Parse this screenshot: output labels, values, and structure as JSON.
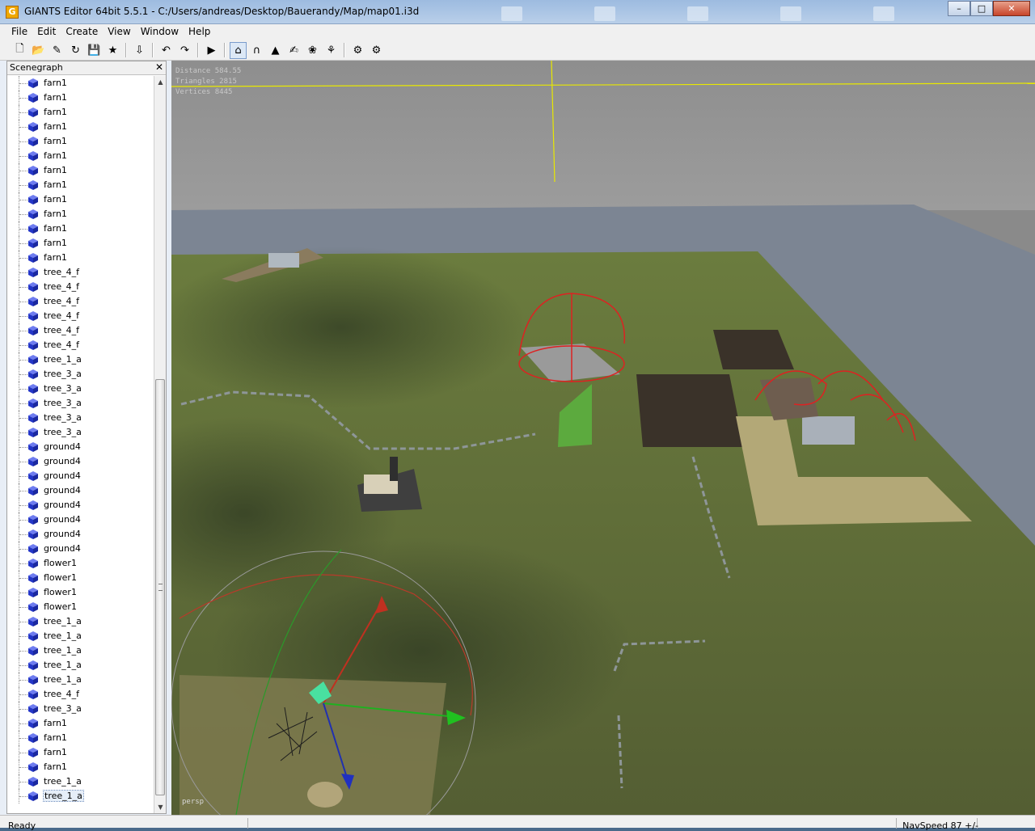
{
  "titlebar": {
    "app_letter": "G",
    "title": "GIANTS Editor 64bit 5.5.1 - C:/Users/andreas/Desktop/Bauerandy/Map/map01.i3d",
    "minimize": "–",
    "maximize": "□",
    "close": "✕"
  },
  "menu": [
    {
      "label": "File"
    },
    {
      "label": "Edit"
    },
    {
      "label": "Create"
    },
    {
      "label": "View"
    },
    {
      "label": "Window"
    },
    {
      "label": "Help"
    }
  ],
  "toolbar": {
    "buttons": [
      {
        "icon": "new-file-icon",
        "glyph": "🗋"
      },
      {
        "icon": "open-folder-icon",
        "glyph": "📂"
      },
      {
        "icon": "edit-icon",
        "glyph": "✎"
      },
      {
        "icon": "refresh-icon",
        "glyph": "↻"
      },
      {
        "icon": "save-icon",
        "glyph": "💾"
      },
      {
        "icon": "save-as-icon",
        "glyph": "★"
      },
      {
        "icon": "import-icon",
        "glyph": "⇩"
      },
      {
        "icon": "undo-icon",
        "glyph": "↶"
      },
      {
        "icon": "redo-icon",
        "glyph": "↷"
      },
      {
        "icon": "play-icon",
        "glyph": "▶"
      },
      {
        "icon": "home-camera-icon",
        "glyph": "⌂"
      },
      {
        "icon": "magnet-icon",
        "glyph": "∩"
      },
      {
        "icon": "terrain-sculpt-icon",
        "glyph": "▲"
      },
      {
        "icon": "terrain-paint-icon",
        "glyph": "✍"
      },
      {
        "icon": "foliage-paint-icon",
        "glyph": "❀"
      },
      {
        "icon": "plant-icon",
        "glyph": "⚘"
      },
      {
        "icon": "settings-icon",
        "glyph": "⚙"
      },
      {
        "icon": "advanced-settings-icon",
        "glyph": "⚙"
      }
    ]
  },
  "scenegraph": {
    "title": "Scenegraph",
    "close_glyph": "✕",
    "items": [
      {
        "label": "farn1"
      },
      {
        "label": "farn1"
      },
      {
        "label": "farn1"
      },
      {
        "label": "farn1"
      },
      {
        "label": "farn1"
      },
      {
        "label": "farn1"
      },
      {
        "label": "farn1"
      },
      {
        "label": "farn1"
      },
      {
        "label": "farn1"
      },
      {
        "label": "farn1"
      },
      {
        "label": "farn1"
      },
      {
        "label": "farn1"
      },
      {
        "label": "farn1"
      },
      {
        "label": "tree_4_f"
      },
      {
        "label": "tree_4_f"
      },
      {
        "label": "tree_4_f"
      },
      {
        "label": "tree_4_f"
      },
      {
        "label": "tree_4_f"
      },
      {
        "label": "tree_4_f"
      },
      {
        "label": "tree_1_a"
      },
      {
        "label": "tree_3_a"
      },
      {
        "label": "tree_3_a"
      },
      {
        "label": "tree_3_a"
      },
      {
        "label": "tree_3_a"
      },
      {
        "label": "tree_3_a"
      },
      {
        "label": "ground4"
      },
      {
        "label": "ground4"
      },
      {
        "label": "ground4"
      },
      {
        "label": "ground4"
      },
      {
        "label": "ground4"
      },
      {
        "label": "ground4"
      },
      {
        "label": "ground4"
      },
      {
        "label": "ground4"
      },
      {
        "label": "flower1"
      },
      {
        "label": "flower1"
      },
      {
        "label": "flower1"
      },
      {
        "label": "flower1"
      },
      {
        "label": "tree_1_a"
      },
      {
        "label": "tree_1_a"
      },
      {
        "label": "tree_1_a"
      },
      {
        "label": "tree_1_a"
      },
      {
        "label": "tree_1_a"
      },
      {
        "label": "tree_4_f"
      },
      {
        "label": "tree_3_a"
      },
      {
        "label": "farn1"
      },
      {
        "label": "farn1"
      },
      {
        "label": "farn1"
      },
      {
        "label": "farn1"
      },
      {
        "label": "tree_1_a"
      },
      {
        "label": "tree_1_a",
        "selected": true
      }
    ]
  },
  "viewport": {
    "hud_distance": "Distance 584.55",
    "hud_triangles": "Triangles 2815",
    "hud_vertices": "Vertices 8445",
    "camera_label": "persp"
  },
  "status": {
    "left": "Ready",
    "right": "NavSpeed 87 +/-"
  }
}
